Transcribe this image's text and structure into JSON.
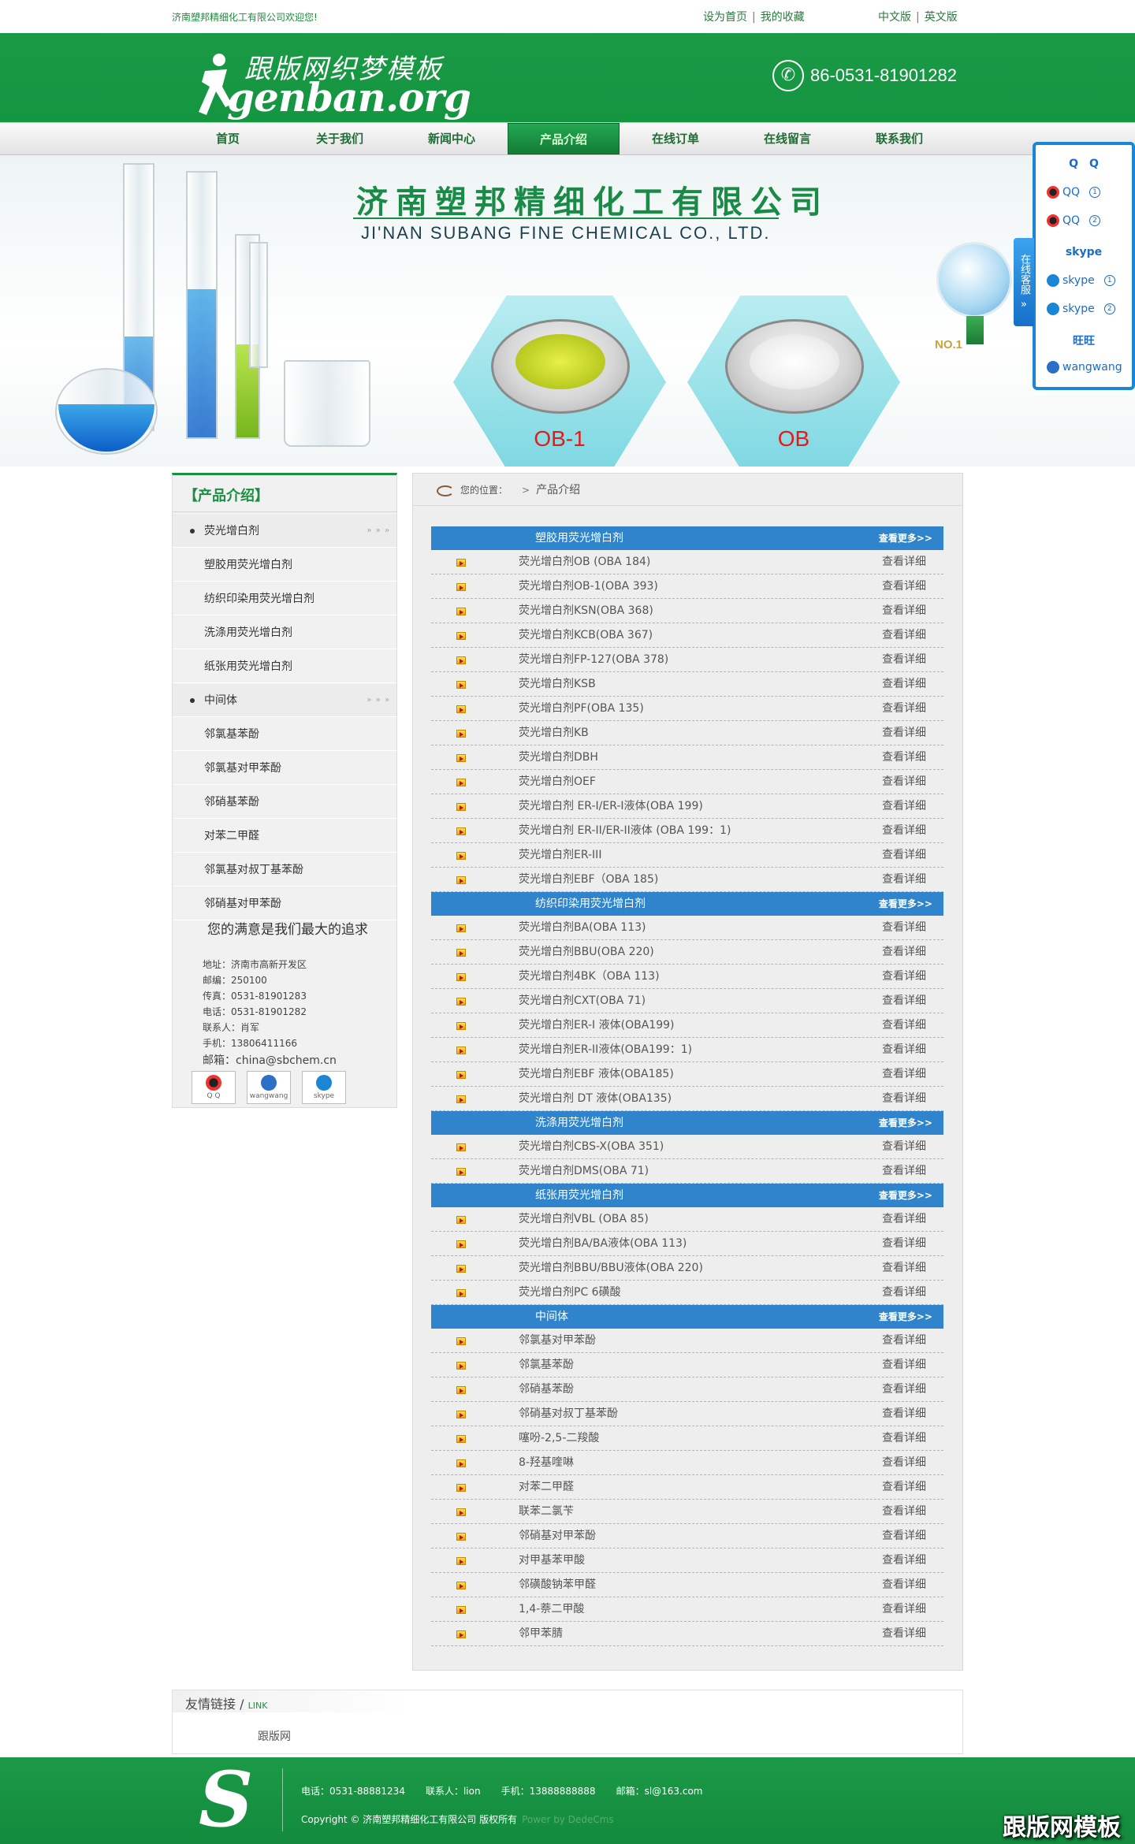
{
  "topbar": {
    "welcome": "济南塑邦精细化工有限公司欢迎您!",
    "set_home": "设为首页",
    "favorites": "我的收藏",
    "lang_cn": "中文版",
    "lang_en": "英文版"
  },
  "header": {
    "logo_cn": "跟版网织梦模板",
    "logo_en": "genban.org",
    "phone": "86-0531-81901282"
  },
  "nav": {
    "items": [
      "首页",
      "关于我们",
      "新闻中心",
      "产品介绍",
      "在线订单",
      "在线留言",
      "联系我们"
    ],
    "active_index": 3
  },
  "banner": {
    "title_cn": "济南塑邦精细化工有限公司",
    "title_en": "JI'NAN SUBANG FINE CHEMICAL CO., LTD.",
    "product1": "OB-1",
    "product2": "OB",
    "badge": "NO.1"
  },
  "service": {
    "tab": "在线客服",
    "qq_head": "QQ",
    "qq1": "QQ",
    "qq2": "QQ",
    "skype_head": "skype",
    "skype1": "skype",
    "skype2": "skype",
    "ww_head": "旺旺",
    "ww1": "wangwang",
    "n1": "1",
    "n2": "2"
  },
  "sidebar": {
    "title": "【产品介绍】",
    "cat1": "荧光增白剂",
    "cat1_subs": [
      "塑胶用荧光增白剂",
      "纺织印染用荧光增白剂",
      "洗涤用荧光增白剂",
      "纸张用荧光增白剂"
    ],
    "cat2": "中间体",
    "cat2_subs": [
      "邻氯基苯酚",
      "邻氯基对甲苯酚",
      "邻硝基苯酚",
      "对苯二甲醛",
      "邻氯基对叔丁基苯酚",
      "邻硝基对甲苯酚"
    ],
    "arrows": "» » »",
    "slogan": "您的满意是我们最大的追求",
    "contact": [
      "地址：济南市高新开发区",
      "邮编：250100",
      "传真：0531-81901283",
      "电话：0531-81901282",
      "联系人：肖军",
      "手机：13806411166",
      "邮箱：china@sbchem.cn"
    ],
    "chat": [
      "Q Q",
      "wangwang",
      "skype"
    ]
  },
  "main": {
    "crumb_label": "您的位置：",
    "crumb_sep": ">",
    "crumb_current": "产品介绍",
    "more": "查看更多>>",
    "detail": "查看详细",
    "sections": [
      {
        "title": "塑胶用荧光增白剂",
        "items": [
          "荧光增白剂OB (OBA 184)",
          "荧光增白剂OB-1(OBA 393)",
          "荧光增白剂KSN(OBA 368)",
          "荧光增白剂KCB(OBA 367)",
          "荧光增白剂FP-127(OBA 378)",
          "荧光增白剂KSB",
          "荧光增白剂PF(OBA 135)",
          "荧光增白剂KB",
          "荧光增白剂DBH",
          "荧光增白剂OEF",
          "荧光增白剂 ER-I/ER-I液体(OBA 199)",
          "荧光增白剂 ER-II/ER-II液体 (OBA 199：1)",
          "荧光增白剂ER-III",
          "荧光增白剂EBF（OBA 185)"
        ]
      },
      {
        "title": "纺织印染用荧光增白剂",
        "items": [
          "荧光增白剂BA(OBA 113)",
          "荧光增白剂BBU(OBA 220)",
          "荧光增白剂4BK（OBA 113)",
          "荧光增白剂CXT(OBA 71)",
          "荧光增白剂ER-I 液体(OBA199)",
          "荧光增白剂ER-II液体(OBA199：1)",
          "荧光增白剂EBF 液体(OBA185)",
          "荧光增白剂 DT 液体(OBA135)"
        ]
      },
      {
        "title": "洗涤用荧光增白剂",
        "items": [
          "荧光增白剂CBS-X(OBA 351)",
          "荧光增白剂DMS(OBA 71)"
        ]
      },
      {
        "title": "纸张用荧光增白剂",
        "items": [
          "荧光增白剂VBL (OBA 85)",
          "荧光增白剂BA/BA液体(OBA 113)",
          "荧光增白剂BBU/BBU液体(OBA 220)",
          "荧光增白剂PC 6磺酸"
        ]
      },
      {
        "title": "中间体",
        "items": [
          "邻氯基对甲苯酚",
          "邻氯基苯酚",
          "邻硝基苯酚",
          "邻硝基对叔丁基苯酚",
          "噻吩-2,5-二羧酸",
          "8-羟基喹啉",
          "对苯二甲醛",
          "联苯二氯苄",
          "邻硝基对甲苯酚",
          "对甲基苯甲酸",
          "邻磺酸钠苯甲醛",
          "1,4-萘二甲酸",
          "邻甲苯腈"
        ]
      }
    ]
  },
  "links": {
    "title": "友情链接",
    "sep": "/",
    "title_en": "LINK",
    "items": [
      "跟版网"
    ]
  },
  "footer": {
    "tel": "电话：0531-88881234",
    "contact": "联系人：lion",
    "mobile": "手机：13888888888",
    "email": "邮箱：sl@163.com",
    "copyright": "Copyright © 济南塑邦精细化工有限公司 版权所有",
    "powered": "Power by DedeCms",
    "watermark": "跟版网模板"
  },
  "colors": {
    "brand_green": "#1b9a46",
    "section_blue": "#2f84cc",
    "service_blue": "#1a86d6",
    "price_red": "#e31b1b"
  }
}
